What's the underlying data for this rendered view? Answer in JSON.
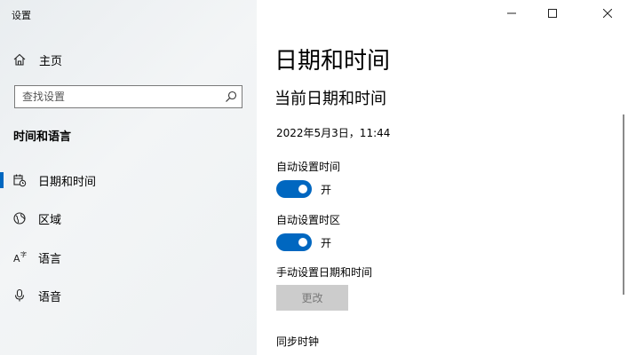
{
  "window": {
    "title": "设置"
  },
  "sidebar": {
    "home_label": "主页",
    "search": {
      "placeholder": "查找设置"
    },
    "section_title": "时间和语言",
    "items": [
      {
        "label": "日期和时间",
        "icon": "calendar-clock-icon",
        "selected": true
      },
      {
        "label": "区域",
        "icon": "globe-icon",
        "selected": false
      },
      {
        "label": "语言",
        "icon": "language-icon",
        "selected": false
      },
      {
        "label": "语音",
        "icon": "microphone-icon",
        "selected": false
      }
    ]
  },
  "main": {
    "page_title": "日期和时间",
    "sub_title": "当前日期和时间",
    "current_datetime": "2022年5月3日，11:44",
    "auto_time": {
      "label": "自动设置时间",
      "state": "开",
      "on": true
    },
    "auto_timezone": {
      "label": "自动设置时区",
      "state": "开",
      "on": true
    },
    "manual": {
      "label": "手动设置日期和时间",
      "button": "更改",
      "enabled": false
    },
    "sync_title": "同步时钟"
  },
  "colors": {
    "accent": "#0067c0",
    "disabled_button": "#cccccc",
    "sidebar_bg": "#eef1f3"
  }
}
